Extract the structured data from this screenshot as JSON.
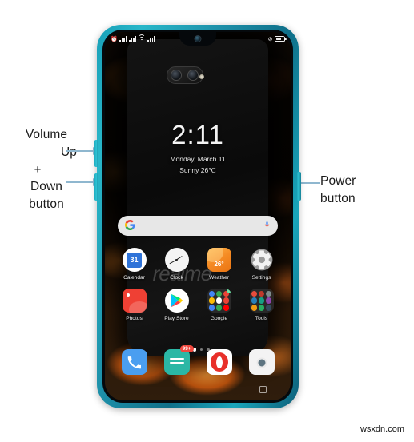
{
  "annotations": {
    "left": {
      "line1": "Volume",
      "line2": "Up",
      "line3": "+",
      "line4": "Down",
      "line5": "button"
    },
    "right": {
      "line1": "Power",
      "line2": "button"
    },
    "arrow_color": "#8fb7cf"
  },
  "phone": {
    "frame_color": "#1d8fa8",
    "button_color": "#2fc5d6",
    "side_buttons": {
      "volume_up": "volume-up-button",
      "volume_down": "volume-down-button",
      "power": "power-button"
    }
  },
  "statusbar": {
    "left_icons": [
      "alarm-icon",
      "signal-bars-icon",
      "signal-bars-icon",
      "wifi-icon",
      "network-icon"
    ],
    "right_icons": [
      "do-not-disturb-icon",
      "battery-icon"
    ],
    "battery_text": ""
  },
  "homescreen": {
    "clock_widget": {
      "time": "2:11",
      "date": "Monday, March 11",
      "weather": "Sunny 26℃"
    },
    "search": {
      "logo": "G",
      "placeholder": "",
      "value": "",
      "mic_icon": "microphone-icon"
    },
    "wallpaper_brand": "realme",
    "app_rows": [
      [
        {
          "label": "Calendar",
          "icon": "calendar-icon",
          "icon_text": "31"
        },
        {
          "label": "Clock",
          "icon": "clock-icon",
          "icon_text": ""
        },
        {
          "label": "Weather",
          "icon": "weather-icon",
          "icon_text": "26°"
        },
        {
          "label": "Settings",
          "icon": "gear-icon",
          "icon_text": ""
        }
      ],
      [
        {
          "label": "Photos",
          "icon": "photos-icon",
          "icon_text": ""
        },
        {
          "label": "Play Store",
          "icon": "play-store-icon",
          "icon_text": ""
        },
        {
          "label": "Google",
          "icon": "folder-icon",
          "icon_text": ""
        },
        {
          "label": "Tools",
          "icon": "folder-icon",
          "icon_text": ""
        }
      ]
    ],
    "page_dots": {
      "count": 4,
      "active_index": 1
    },
    "dock": [
      {
        "label": "",
        "icon": "phone-icon",
        "badge": ""
      },
      {
        "label": "",
        "icon": "messages-icon",
        "badge": "99+"
      },
      {
        "label": "",
        "icon": "opera-icon",
        "badge": ""
      },
      {
        "label": "",
        "icon": "camera-icon",
        "badge": ""
      }
    ],
    "nav": {
      "recents": "recents-square-button"
    }
  },
  "watermark": "wsxdn.com"
}
